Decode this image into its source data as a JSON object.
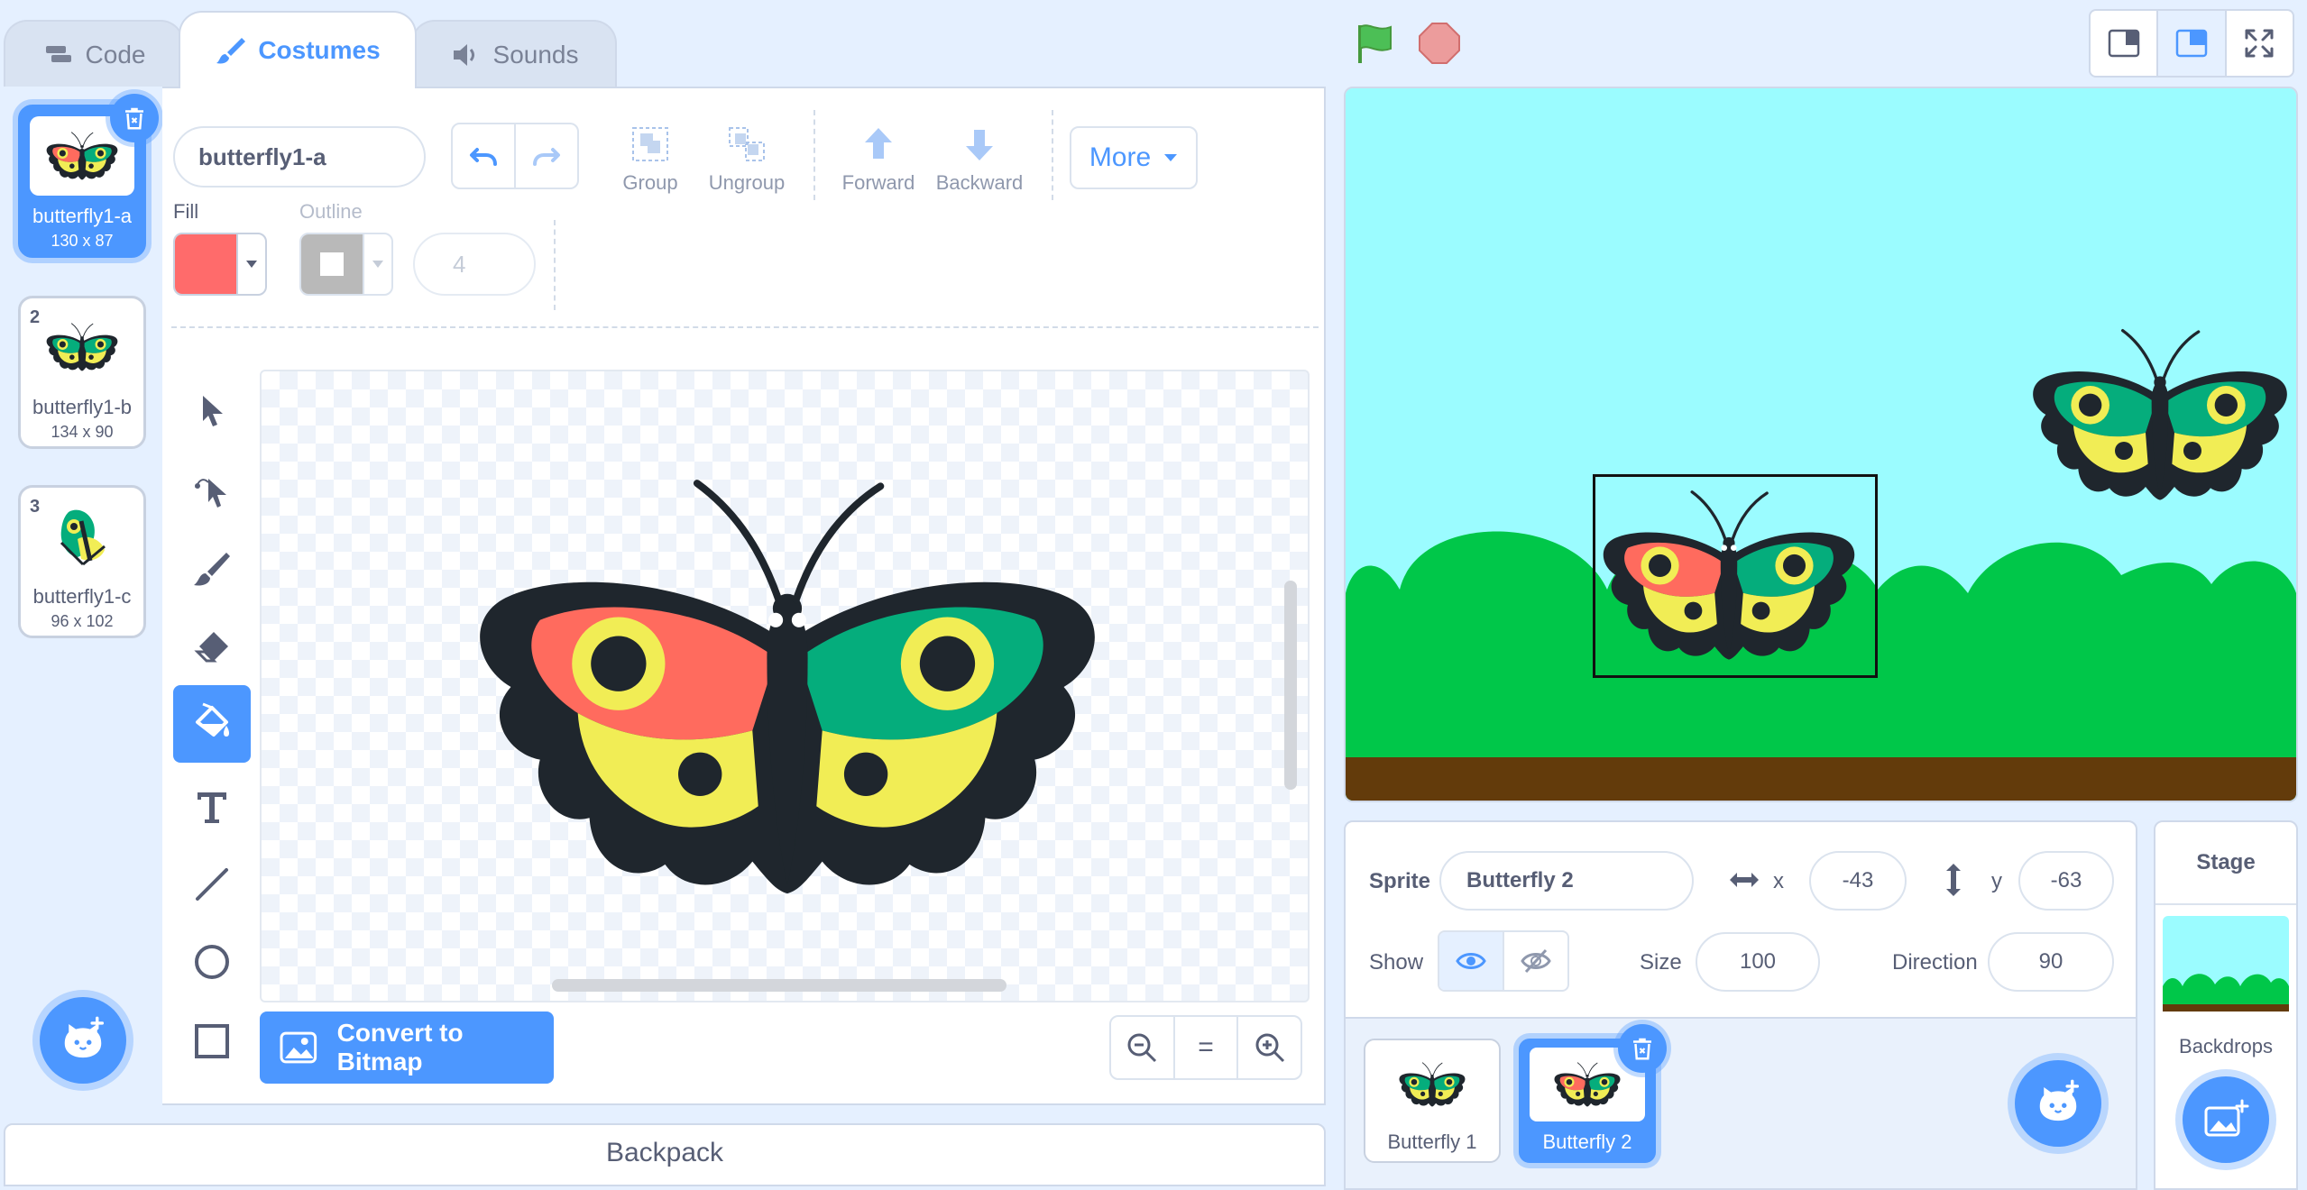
{
  "tabs": [
    {
      "label": "Code",
      "icon": "code-icon",
      "active": false
    },
    {
      "label": "Costumes",
      "icon": "brush-icon",
      "active": true
    },
    {
      "label": "Sounds",
      "icon": "speaker-icon",
      "active": false
    }
  ],
  "costumes": [
    {
      "number": "1",
      "name": "butterfly1-a",
      "size": "130 x 87",
      "selected": true
    },
    {
      "number": "2",
      "name": "butterfly1-b",
      "size": "134 x 90",
      "selected": false
    },
    {
      "number": "3",
      "name": "butterfly1-c",
      "size": "96 x 102",
      "selected": false
    }
  ],
  "editor": {
    "costume_name": "butterfly1-a",
    "group_label": "Group",
    "ungroup_label": "Ungroup",
    "forward_label": "Forward",
    "backward_label": "Backward",
    "more_label": "More",
    "fill_label": "Fill",
    "outline_label": "Outline",
    "fill_color": "#ff6b6b",
    "outline_color": "#b9b9b9",
    "stroke_width": "4",
    "convert_label": "Convert to Bitmap",
    "zoom_out": "zoom-out-icon",
    "zoom_reset": "=",
    "zoom_in": "zoom-in-icon"
  },
  "backpack_label": "Backpack",
  "sprite_info": {
    "sprite_label": "Sprite",
    "sprite_name": "Butterfly 2",
    "x_label": "x",
    "x_value": "-43",
    "y_label": "y",
    "y_value": "-63",
    "show_label": "Show",
    "size_label": "Size",
    "size_value": "100",
    "direction_label": "Direction",
    "direction_value": "90"
  },
  "sprites": [
    {
      "name": "Butterfly 1",
      "selected": false
    },
    {
      "name": "Butterfly 2",
      "selected": true
    }
  ],
  "stage_panel": {
    "title": "Stage",
    "backdrops_label": "Backdrops"
  },
  "colors": {
    "accent": "#4c97ff",
    "stage_sky": "#9bfcff",
    "stage_grass": "#00c749",
    "stage_ground": "#633b0b"
  }
}
